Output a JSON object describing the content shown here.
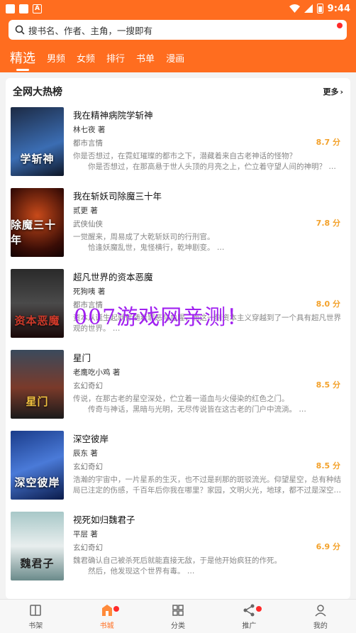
{
  "status": {
    "time": "9:44"
  },
  "search": {
    "placeholder": "搜书名、作者、主角，一搜即有"
  },
  "tabs": [
    {
      "label": "精选",
      "active": true
    },
    {
      "label": "男频"
    },
    {
      "label": "女频"
    },
    {
      "label": "排行"
    },
    {
      "label": "书单"
    },
    {
      "label": "漫画"
    }
  ],
  "section": {
    "title": "全网大热榜",
    "more": "更多"
  },
  "books": [
    {
      "title": "我在精神病院学斩神",
      "author": "林七夜 著",
      "category": "都市言情",
      "score": "8.7 分",
      "desc": "你是否想过，在霓虹璀璨的都市之下，潜藏着来自古老神话的怪物？\n　　你是否想过，在那高悬于世人头顶的月亮之上，伫立着守望人间的神明？ …",
      "cover_text": "学斩神"
    },
    {
      "title": "我在斩妖司除魔三十年",
      "author": "贰更 著",
      "category": "武侠仙侠",
      "score": "7.8 分",
      "desc": "一觉醒来，周易成了大乾斩妖司的行刑官。\n　　恰逢妖魔乱世，鬼怪横行，乾坤剧变。 …",
      "cover_text": "除魔三十年"
    },
    {
      "title": "超凡世界的资本恶魔",
      "author": "死狗咦 著",
      "category": "都市言情",
      "score": "8.0 分",
      "desc": "资本从诞生起就伴随着罪恶与血腥，而这一刻资本主义穿越到了一个具有超凡世界观的世界。 …",
      "cover_text": "资本恶魔"
    },
    {
      "title": "星门",
      "author": "老鹰吃小鸡 著",
      "category": "玄幻奇幻",
      "score": "8.5 分",
      "desc": "传说，在那古老的星空深处，伫立着一道血与火侵染的红色之门。\n　　传奇与神话，黑暗与光明，无尽传说皆在这古老的门户中流淌。 …",
      "cover_text": "星门"
    },
    {
      "title": "深空彼岸",
      "author": "辰东 著",
      "category": "玄幻奇幻",
      "score": "8.5 分",
      "desc": "浩瀚的宇宙中，一片星系的生灭，也不过是刹那的斑驳流光。仰望星空，总有种结局已注定的伤感，千百年后你我在哪里？家园，文明火光，地球，都不过是深空…",
      "cover_text": "深空彼岸"
    },
    {
      "title": "视死如归魏君子",
      "author": "平层 著",
      "category": "玄幻奇幻",
      "score": "6.9 分",
      "desc": "魏君确认自己被杀死后就能直接无敌，于是他开始疯狂的作死。\n　　然后，他发现这个世界有毒。 …",
      "cover_text": "魏君子"
    }
  ],
  "watermark": "007游戏网亲测！",
  "nav": [
    {
      "label": "书架",
      "icon": "bookshelf-icon"
    },
    {
      "label": "书城",
      "icon": "store-icon",
      "active": true,
      "dot": true
    },
    {
      "label": "分类",
      "icon": "category-icon"
    },
    {
      "label": "推广",
      "icon": "share-icon",
      "dot": true
    },
    {
      "label": "我的",
      "icon": "profile-icon"
    }
  ],
  "colors": {
    "accent": "#ff6d1f",
    "score": "#f3a12a",
    "watermark": "#a020f0"
  }
}
